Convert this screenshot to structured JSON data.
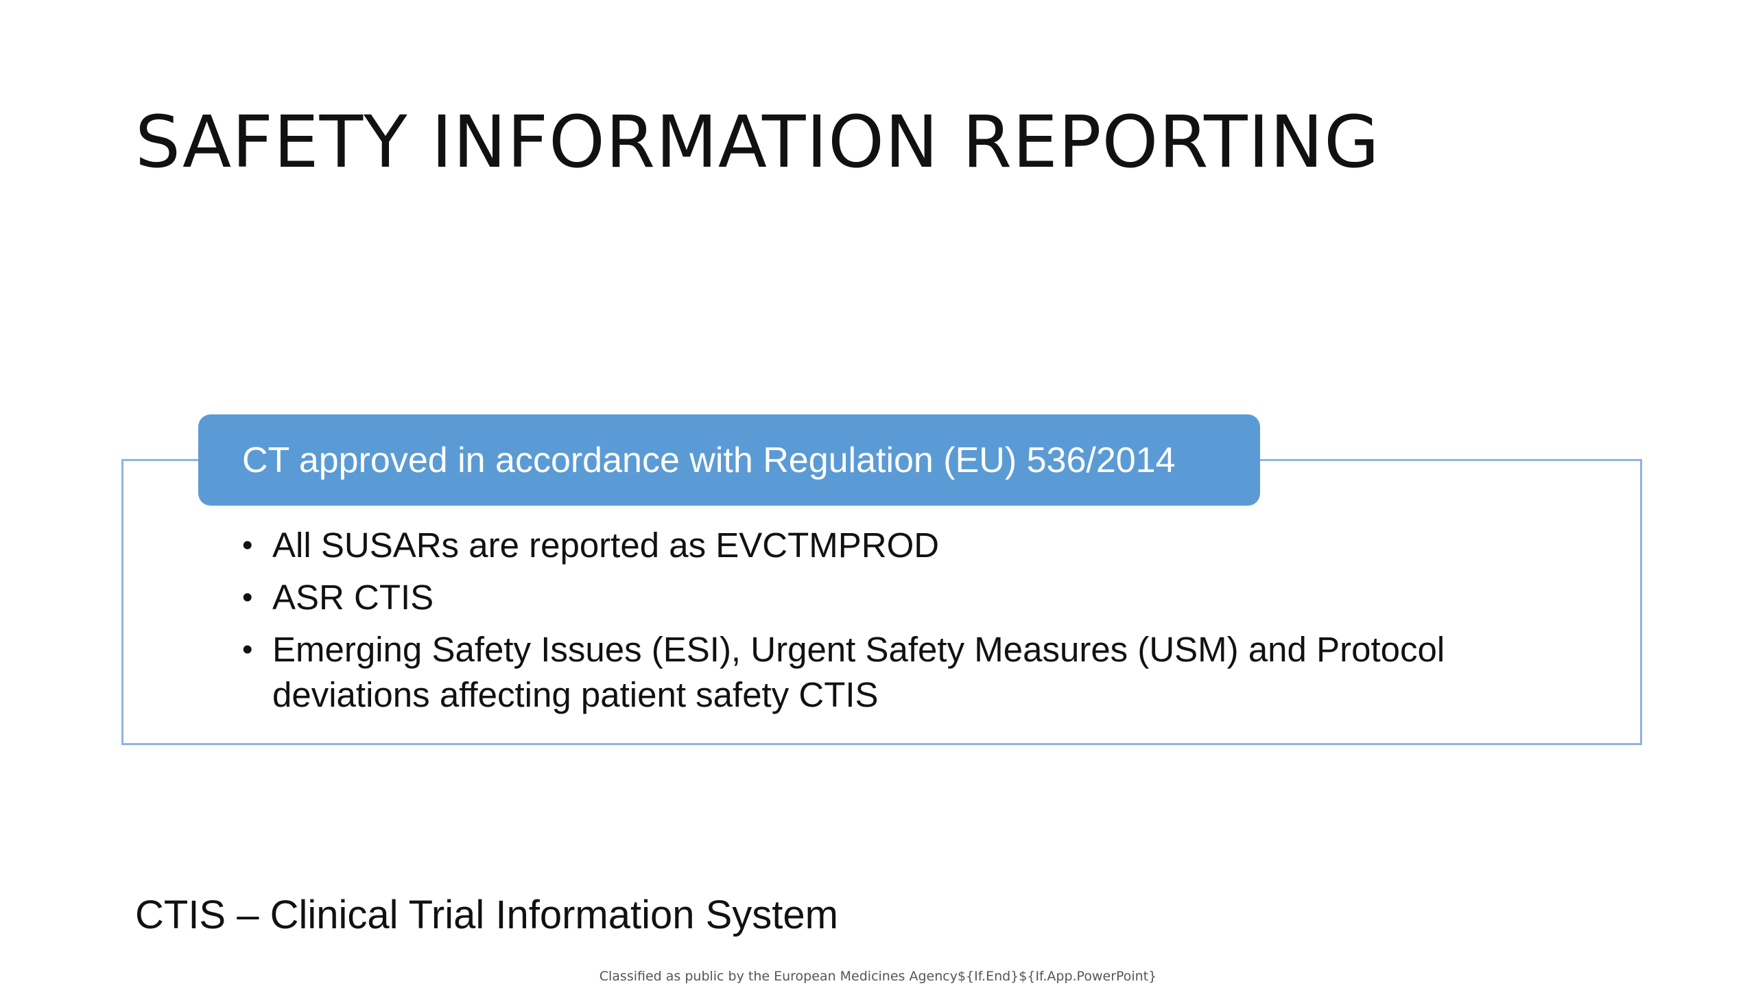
{
  "slide": {
    "title": "SAFETY INFORMATION REPORTING",
    "box": {
      "header": "CT approved in accordance with Regulation (EU) 536/2014",
      "bullets": [
        "All SUSARs are reported as EVCTMPROD",
        "ASR CTIS",
        "Emerging Safety Issues (ESI), Urgent Safety Measures (USM) and Protocol deviations affecting patient safety CTIS"
      ]
    },
    "footer_note": "CTIS – Clinical Trial Information System",
    "classification": "Classified as public by the European Medicines Agency${If.End}${If.App.PowerPoint}"
  },
  "colors": {
    "header_fill": "#5b9bd5",
    "frame_border": "#8fb3e3",
    "text": "#111111"
  }
}
